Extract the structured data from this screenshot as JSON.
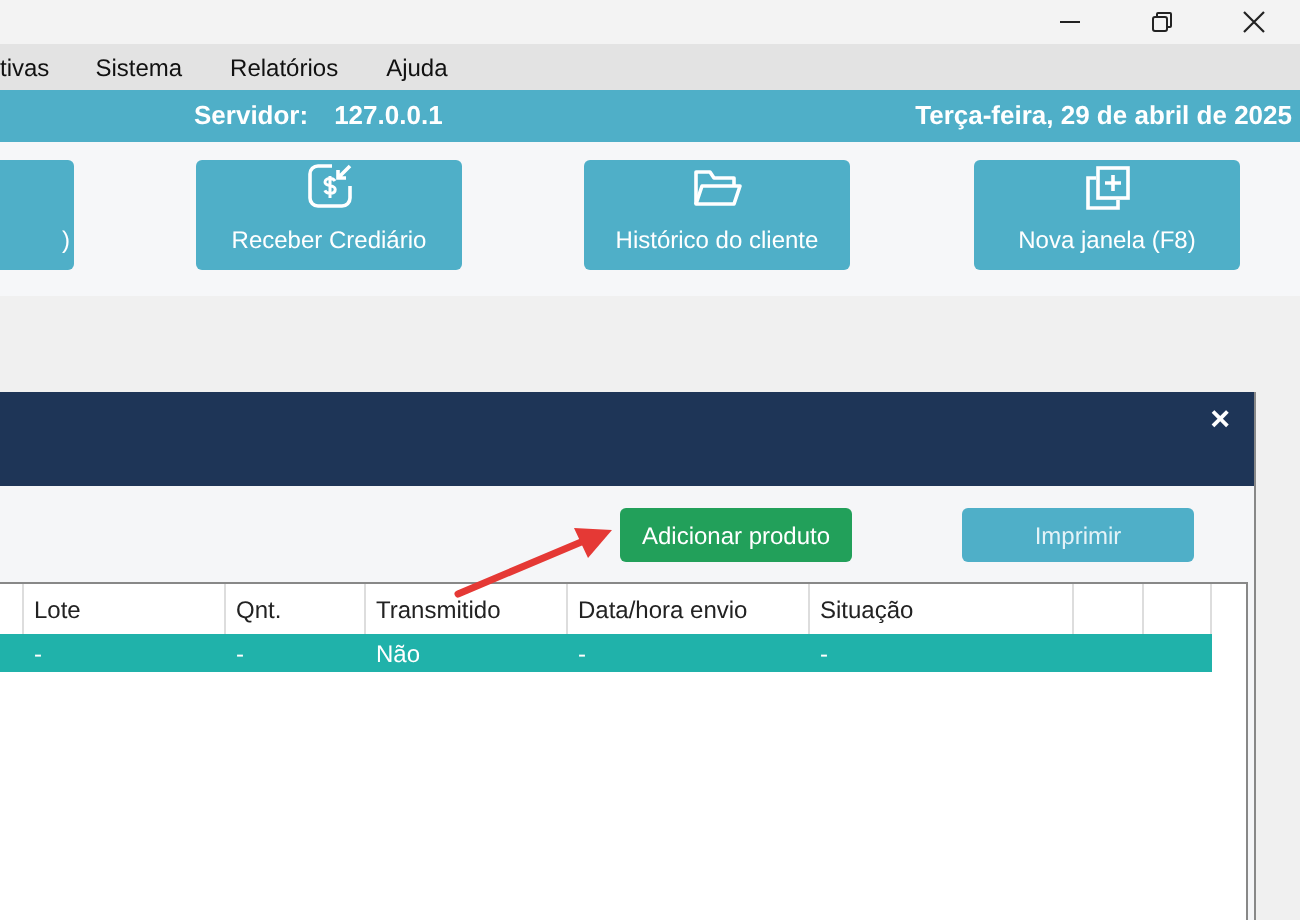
{
  "menu": [
    "tivas",
    "Sistema",
    "Relatórios",
    "Ajuda"
  ],
  "info_bar": {
    "server_label": "Servidor:",
    "server": "127.0.0.1",
    "date": "Terça-feira, 29 de abril de 2025"
  },
  "toolbar": [
    {
      "label": ")",
      "kind": "plain"
    },
    {
      "label": "Receber Crediário",
      "kind": "money"
    },
    {
      "label": "Histórico do cliente",
      "kind": "folder"
    },
    {
      "label": "Nova janela (F8)",
      "kind": "window"
    }
  ],
  "dialog": {
    "close": "×",
    "buttons": [
      {
        "label": "Adicionar produto",
        "kind": "primary",
        "disabled": false
      },
      {
        "label": "Imprimir",
        "kind": "secondary",
        "disabled": true
      }
    ],
    "table": {
      "columns": [
        "",
        "Lote",
        "Qnt.",
        "Transmitido",
        "Data/hora envio",
        "Situação",
        "",
        ""
      ],
      "rows": [
        {
          "selected": true,
          "cells": [
            "",
            "-",
            "-",
            "Não",
            "-",
            "-",
            "",
            ""
          ]
        }
      ]
    }
  }
}
